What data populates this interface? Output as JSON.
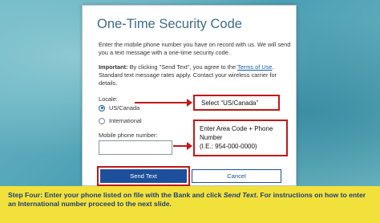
{
  "dialog": {
    "title": "One-Time Security Code",
    "intro": "Enter the mobile phone number you have on record with us. We will send you a text message with a one-time security code.",
    "important_label": "Important:",
    "important_text_1": " By clicking \"Send Text\", you agree to the ",
    "terms_link": "Terms of Use",
    "important_text_2": ". Standard text message rates apply. Contact your wireless carrier for details.",
    "locale_label": "Locale:",
    "locale_options": [
      {
        "label": "US/Canada",
        "checked": true
      },
      {
        "label": "International",
        "checked": false
      }
    ],
    "phone_label": "Mobile phone number:",
    "phone_value": "",
    "send_label": "Send Text",
    "cancel_label": "Cancel"
  },
  "callouts": {
    "locale": "Select “US/Canada”",
    "phone_line1": "Enter Area Code + Phone",
    "phone_line2": "Number",
    "phone_line3": "(I.E.: 954-000-0000)"
  },
  "footer": {
    "text_1": "Step Four: Enter your phone listed on file with the Bank and click ",
    "italic": "Send Text",
    "text_2": ". For instructions on how to enter an International number proceed to the next slide."
  },
  "colors": {
    "accent": "#1d4f9a",
    "highlight_red": "#c01818",
    "footer_yellow": "#f2e13a",
    "title_blue": "#3d6b8a"
  }
}
